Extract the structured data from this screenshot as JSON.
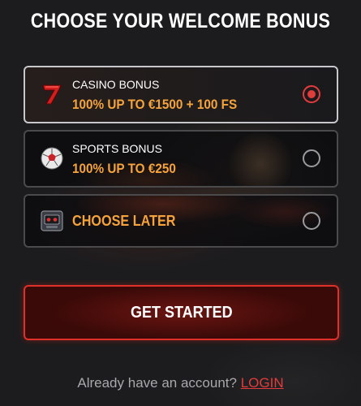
{
  "title": "CHOOSE YOUR WELCOME BONUS",
  "options": [
    {
      "label": "CASINO BONUS",
      "value": "100% UP TO €1500 + 100 FS",
      "selected": true,
      "icon": "lucky-seven-icon"
    },
    {
      "label": "SPORTS BONUS",
      "value": "100% UP TO €250",
      "selected": false,
      "icon": "soccer-ball-icon"
    },
    {
      "label": "",
      "value": "CHOOSE LATER",
      "selected": false,
      "icon": "slot-machine-icon"
    }
  ],
  "cta": {
    "label": "GET STARTED"
  },
  "footer": {
    "text": "Already have an account?",
    "link": "LOGIN"
  },
  "colors": {
    "accent": "#e23b3b",
    "bonus_text": "#f5a33a",
    "background": "#1c1c1e"
  }
}
